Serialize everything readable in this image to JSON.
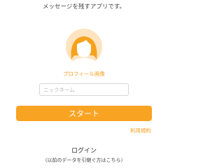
{
  "header": {
    "tagline": "メッセージを残すアプリです。"
  },
  "profile": {
    "avatar_icon": "default-avatar-icon",
    "label": "プロフィール画像",
    "avatar_bg_color": "#fde3bf",
    "avatar_hair_color": "#f7a21b",
    "avatar_face_color": "#ffffff"
  },
  "form": {
    "nickname_placeholder": "ニックネーム",
    "nickname_value": "",
    "start_label": "スタート",
    "terms_label": "利用規約"
  },
  "login": {
    "label": "ログイン",
    "note": "（以前のデータを引継ぐ方はこちら）"
  },
  "colors": {
    "accent": "#f79d1e",
    "button": "#f9a323",
    "button_text": "#ffffff"
  }
}
